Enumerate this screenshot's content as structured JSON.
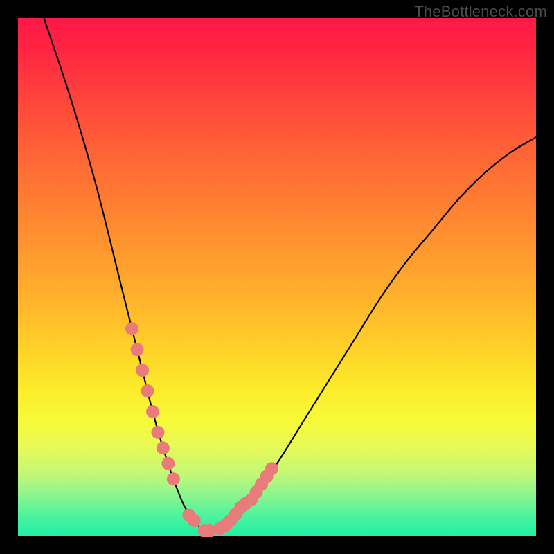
{
  "watermark": "TheBottleneck.com",
  "chart_data": {
    "type": "line",
    "title": "",
    "xlabel": "",
    "ylabel": "",
    "xlim": [
      0,
      100
    ],
    "ylim": [
      0,
      100
    ],
    "series": [
      {
        "name": "bottleneck-curve",
        "x": [
          5,
          10,
          15,
          20,
          22,
          24,
          26,
          28,
          30,
          32,
          34,
          36,
          38,
          40,
          45,
          50,
          55,
          60,
          65,
          70,
          75,
          80,
          85,
          90,
          95,
          100
        ],
        "values": [
          100,
          85,
          68,
          48,
          40,
          32,
          24,
          17,
          11,
          6,
          3,
          1,
          1,
          2,
          7,
          14,
          22,
          30,
          38,
          46,
          53,
          59,
          65,
          70,
          74,
          77
        ]
      }
    ],
    "markers": {
      "name": "highlighted-points",
      "x": [
        22,
        23,
        24,
        25,
        26,
        27,
        28,
        29,
        30,
        33,
        34,
        36,
        37,
        39,
        40,
        41,
        42,
        43,
        44,
        45,
        46,
        47,
        48,
        49
      ],
      "values": [
        40,
        36,
        32,
        28,
        24,
        20,
        17,
        14,
        11,
        4,
        3,
        1,
        1,
        1.5,
        2,
        3,
        4.2,
        5.5,
        6.3,
        7,
        8.5,
        10,
        11.5,
        13
      ]
    },
    "gradient_stops": [
      {
        "pos": 0.0,
        "color": "#ff1947"
      },
      {
        "pos": 0.3,
        "color": "#ff6f34"
      },
      {
        "pos": 0.64,
        "color": "#ffd228"
      },
      {
        "pos": 0.82,
        "color": "#e6fa58"
      },
      {
        "pos": 1.0,
        "color": "#1ef1a6"
      }
    ]
  }
}
